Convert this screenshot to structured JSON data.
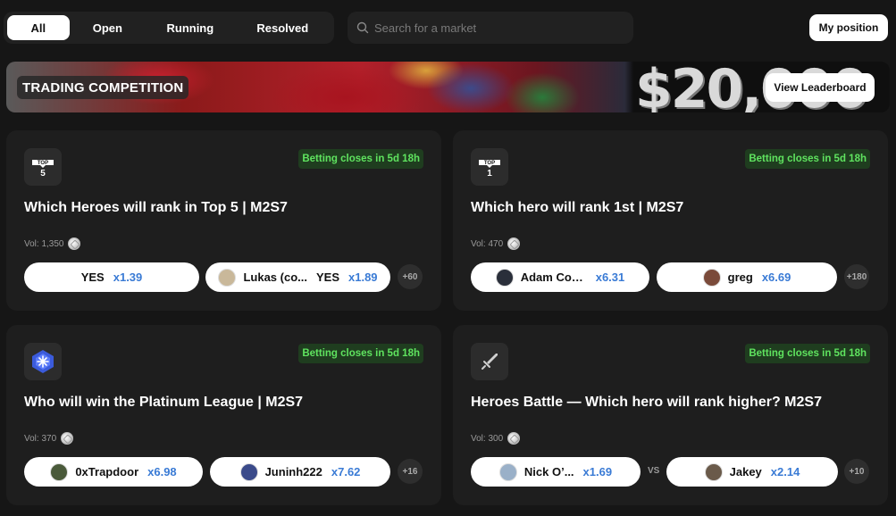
{
  "filters": {
    "tabs": [
      "All",
      "Open",
      "Running",
      "Resolved"
    ],
    "active": "All"
  },
  "search": {
    "placeholder": "Search for a market"
  },
  "header": {
    "my_position": "My position"
  },
  "banner": {
    "title": "TRADING COMPETITION",
    "prize": "$20,000",
    "cta": "View Leaderboard"
  },
  "cards": [
    {
      "icon": "top5-icon",
      "icon_text": "TOP 5",
      "closes": "Betting closes in 5d 18h",
      "title": "Which Heroes will rank in Top 5 | M2S7",
      "vol": "Vol: 1,350",
      "options": [
        {
          "label": "YES",
          "mult": "x1.39"
        },
        {
          "name": "Lukas (co...",
          "label": "YES",
          "mult": "x1.89",
          "avatar": "#c9b89a"
        }
      ],
      "more": "+60"
    },
    {
      "icon": "top1-icon",
      "icon_text": "TOP 1",
      "closes": "Betting closes in 5d 18h",
      "title": "Which hero will rank 1st | M2S7",
      "vol": "Vol: 470",
      "options": [
        {
          "name": "Adam Coc...",
          "mult": "x6.31",
          "avatar": "#2a2f3a"
        },
        {
          "name": "greg",
          "mult": "x6.69",
          "avatar": "#7a4a3a"
        }
      ],
      "more": "+180"
    },
    {
      "icon": "platinum-league-icon",
      "closes": "Betting closes in 5d 18h",
      "title": "Who will win the Platinum League | M2S7",
      "vol": "Vol: 370",
      "options": [
        {
          "name": "0xTrapdoor",
          "mult": "x6.98",
          "avatar": "#4a5a3a"
        },
        {
          "name": "Juninh222",
          "mult": "x7.62",
          "avatar": "#3a4a8a"
        }
      ],
      "more": "+16"
    },
    {
      "icon": "sword-icon",
      "closes": "Betting closes in 5d 18h",
      "title": "Heroes Battle — Which hero will rank higher? M2S7",
      "vol": "Vol: 300",
      "options": [
        {
          "name": "Nick O’...",
          "mult": "x1.69",
          "avatar": "#9ab0c8"
        },
        {
          "name": "Jakey",
          "mult": "x2.14",
          "avatar": "#6a5a4a"
        }
      ],
      "vs": "VS",
      "more": "+10"
    }
  ],
  "colors": {
    "background": "#161616",
    "card": "#1e1e1e",
    "badge_bg": "#1f3d1f",
    "badge_text": "#5fe35f",
    "multiplier": "#3a7bd5"
  }
}
